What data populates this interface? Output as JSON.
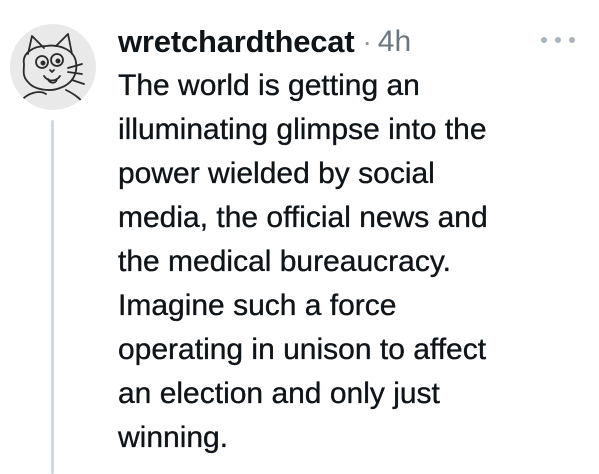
{
  "post": {
    "username": "wretchardthecat",
    "separator": "·",
    "time": "4h",
    "more_icon": "more-horizontal-icon",
    "avatar_icon": "cartoon-cat-avatar-icon",
    "body_lines": [
      "The world is getting an",
      "illuminating glimpse into the",
      "power wielded by social",
      "media, the official news and",
      "the medical bureaucracy.",
      "Imagine such a force",
      "operating in unison to affect",
      "an election and only just",
      "winning."
    ]
  },
  "colors": {
    "text": "#0f1419",
    "muted": "#6b7780",
    "thread_line": "#cfd9de",
    "avatar_bg": "#e9e9ea"
  }
}
